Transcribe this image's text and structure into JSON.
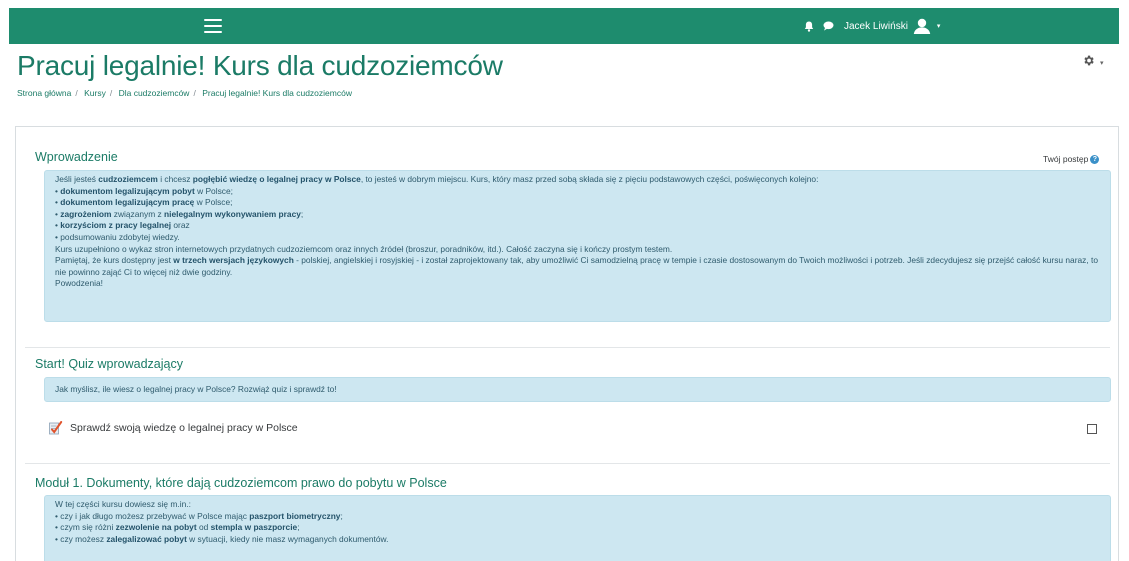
{
  "header": {
    "user_name": "Jacek Liwiński",
    "menu_icon": "hamburger-icon",
    "notification_icon": "bell-icon",
    "messages_icon": "chat-bubble-icon",
    "avatar_icon": "user-avatar-icon",
    "accent_color": "#1e8c6e"
  },
  "page": {
    "title": "Pracuj legalnie! Kurs dla cudzoziemców",
    "settings_icon": "gear-icon"
  },
  "breadcrumb": [
    "Strona główna",
    "Kursy",
    "Dla cudzoziemców",
    "Pracuj legalnie! Kurs dla cudzoziemców"
  ],
  "sections": {
    "intro": {
      "title": "Wprowadzenie",
      "progress_label": "Twój postęp",
      "summary": {
        "p1_a": "Jeśli jesteś ",
        "p1_b": "cudzoziemcem",
        "p1_c": " i chcesz ",
        "p1_d": "pogłębić wiedzę o legalnej pracy w Polsce",
        "p1_e": ", to jesteś w dobrym miejscu. Kurs, który masz przed sobą składa się z pięciu podstawowych części, poświęconych kolejno:",
        "b1_a": "dokumentom legalizującym pobyt",
        "b1_b": " w Polsce;",
        "b2_a": "dokumentom legalizującym pracę",
        "b2_b": " w Polsce;",
        "b3_a": "zagrożeniom",
        "b3_b": " związanym z ",
        "b3_c": "nielegalnym wykonywaniem pracy",
        "b3_d": ";",
        "b4_a": "korzyściom z pracy legalnej",
        "b4_b": " oraz",
        "b5": "podsumowaniu zdobytej wiedzy.",
        "p2": "Kurs uzupełniono o wykaz stron internetowych przydatnych cudzoziemcom oraz innych źródeł (broszur, poradników, itd.). Całość zaczyna się i kończy prostym testem.",
        "p3_a": "Pamiętaj, że kurs dostępny jest ",
        "p3_b": "w trzech wersjach językowych",
        "p3_c": " - polskiej, angielskiej i rosyjskiej - i został zaprojektowany tak, aby umożliwić Ci samodzielną pracę w tempie i czasie dostosowanym do Twoich możliwości i potrzeb. Jeśli zdecydujesz się przejść całość kursu naraz, to nie powinno zająć Ci to więcej niż dwie godziny.",
        "p4": "Powodzenia!"
      }
    },
    "quiz": {
      "title": "Start! Quiz wprowadzający",
      "summary": "Jak myślisz, ile wiesz o legalnej pracy w Polsce? Rozwiąż quiz i sprawdź to!",
      "activity_label": "Sprawdź swoją wiedzę o legalnej pracy w Polsce",
      "activity_icon": "quiz-icon",
      "completion_checked": false
    },
    "module1": {
      "title": "Moduł 1. Dokumenty, które dają cudzoziemcom prawo do pobytu w Polsce",
      "summary": {
        "intro": "W tej części kursu dowiesz się m.in.:",
        "b1_a": "czy i jak długo możesz przebywać w Polsce mając ",
        "b1_b": "paszport biometryczny",
        "b1_c": ";",
        "b2_a": "czym się różni ",
        "b2_b": "zezwolenie na pobyt",
        "b2_c": " od ",
        "b2_d": "stempla w paszporcie",
        "b2_e": ";",
        "b3_a": "czy możesz ",
        "b3_b": "zalegalizować pobyt",
        "b3_c": " w sytuacji, kiedy nie masz wymaganych dokumentów."
      }
    }
  }
}
